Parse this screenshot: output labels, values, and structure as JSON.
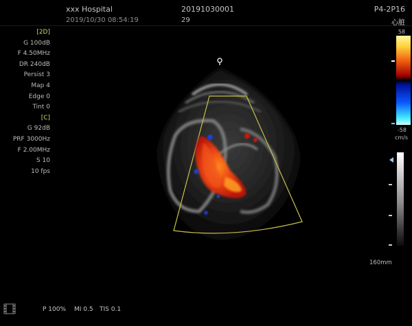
{
  "header": {
    "hospital": "xxx Hospital",
    "datetime": "2019/10/30 08:54:19",
    "patient_id": "20191030001",
    "frame": "29",
    "probe": "P4-2P16",
    "exam": "心脏"
  },
  "params": {
    "section_2d": "[2D]",
    "gain_2d": "G 100dB",
    "freq_2d": "F 4.50MHz",
    "dr": "DR 240dB",
    "persist": "Persist 3",
    "map": "Map 4",
    "edge": "Edge 0",
    "tint": "Tint 0",
    "section_c": "[C]",
    "gain_c": "G 92dB",
    "prf": "PRF 3000Hz",
    "freq_c": "F 2.00MHz",
    "s": "S 10",
    "fps": "10 fps"
  },
  "color_scale": {
    "max": "58",
    "min": "-58",
    "unit": "cm/s"
  },
  "depth": "160mm",
  "footer": {
    "power": "P 100%",
    "mi": "MI 0.5",
    "tis": "TIS 0.1"
  },
  "colors": {
    "accent": "#d9d36a",
    "sector_outline": "#c8c24a",
    "doppler_red": "#e0321a",
    "doppler_blue": "#1c3fd0"
  }
}
